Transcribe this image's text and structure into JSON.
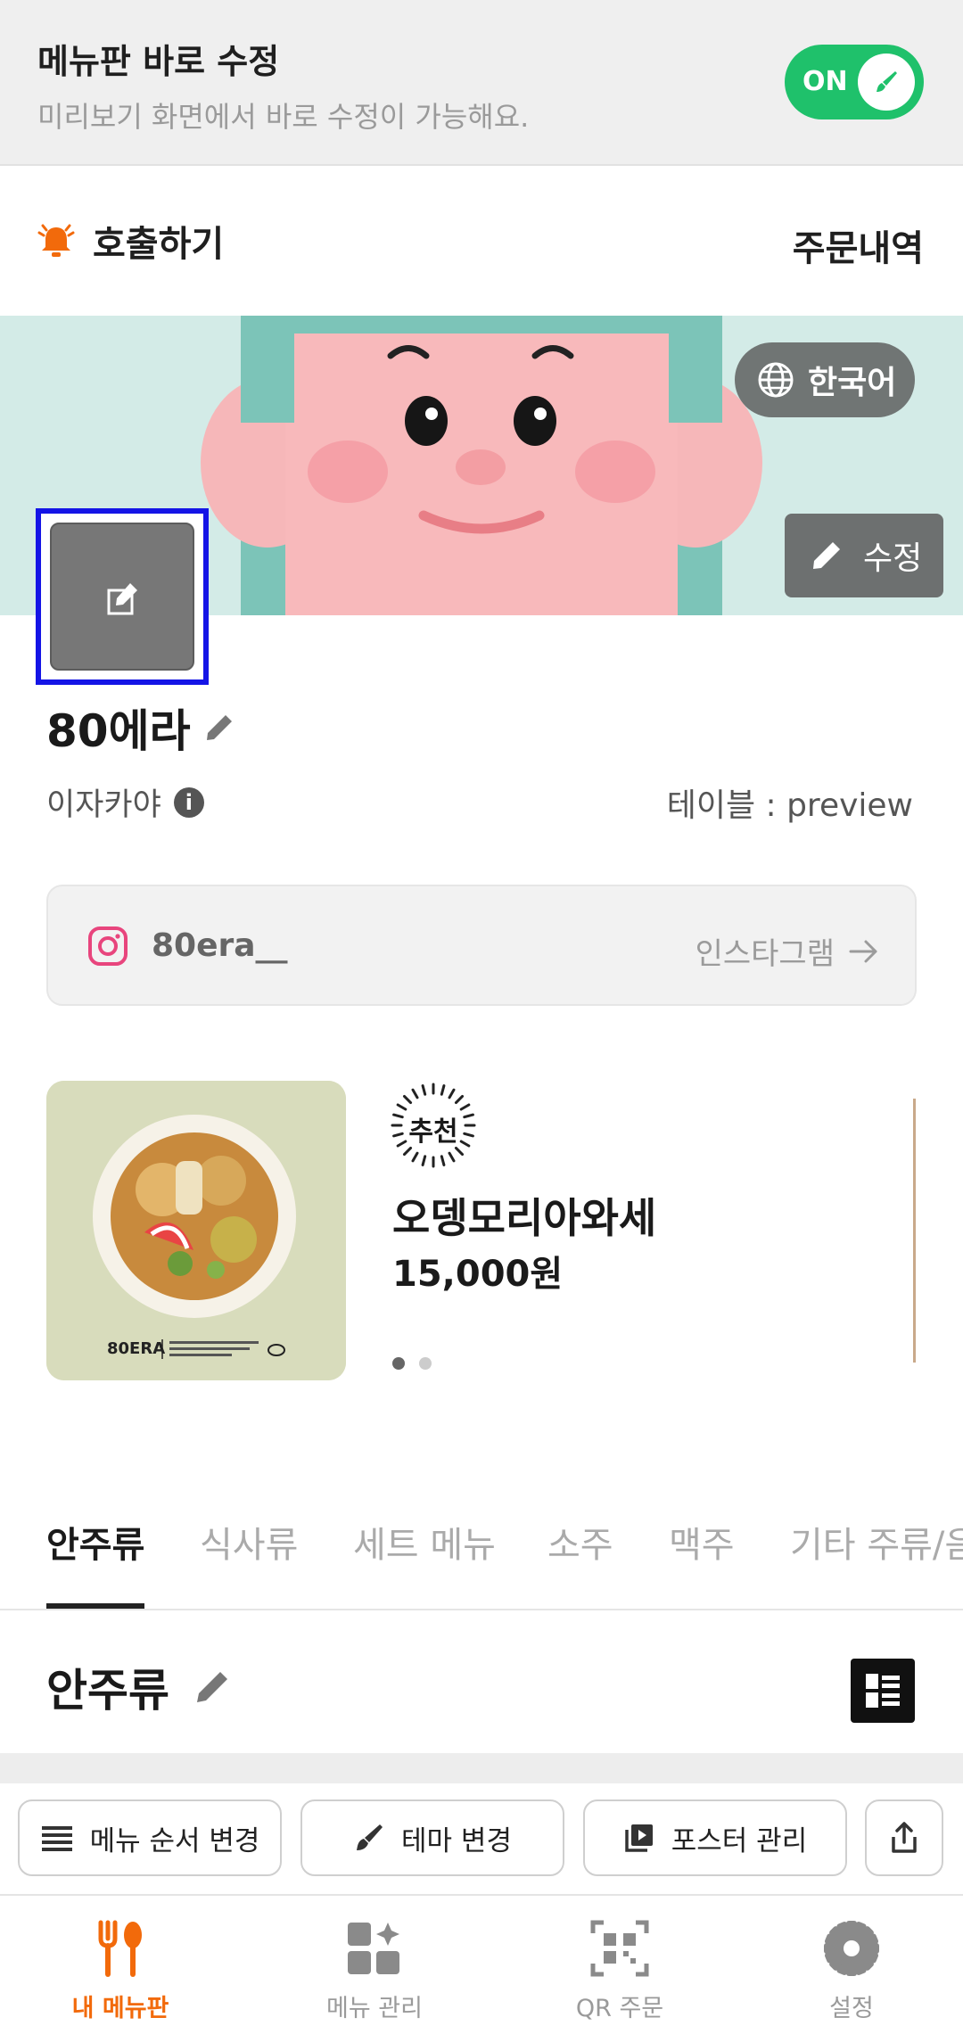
{
  "edit_bar": {
    "title": "메뉴판 바로 수정",
    "subtitle": "미리보기 화면에서 바로 수정이 가능해요.",
    "toggle_label": "ON",
    "toggle_on": true,
    "accent": "#1fc16b"
  },
  "top": {
    "call_label": "호출하기",
    "orders_label": "주문내역",
    "bell_icon": "bell-icon",
    "bell_color": "#f26a0b"
  },
  "banner": {
    "language_label": "한국어",
    "edit_label": "수정"
  },
  "store": {
    "name": "80에라",
    "category": "이자카야",
    "table_label": "테이블 : preview"
  },
  "instagram": {
    "handle": "80era__",
    "link_label": "인스타그램"
  },
  "featured": {
    "badge": "추천",
    "name": "오뎅모리아와세",
    "price": "15,000원",
    "page_count": 2,
    "current_page": 1
  },
  "tabs": {
    "items": [
      "안주류",
      "식사류",
      "세트 메뉴",
      "소주",
      "맥주",
      "기타 주류/음"
    ],
    "active_index": 0
  },
  "section": {
    "title": "안주류"
  },
  "actions": {
    "reorder": "메뉴 순서 변경",
    "theme": "테마 변경",
    "poster": "포스터 관리"
  },
  "nav": {
    "items": [
      {
        "label": "내 메뉴판",
        "icon": "fork-knife-icon",
        "active": true
      },
      {
        "label": "메뉴 관리",
        "icon": "grid-sparkle-icon",
        "active": false
      },
      {
        "label": "QR 주문",
        "icon": "qr-icon",
        "active": false
      },
      {
        "label": "설정",
        "icon": "gear-icon",
        "active": false
      }
    ],
    "active_color": "#f26a0b"
  }
}
